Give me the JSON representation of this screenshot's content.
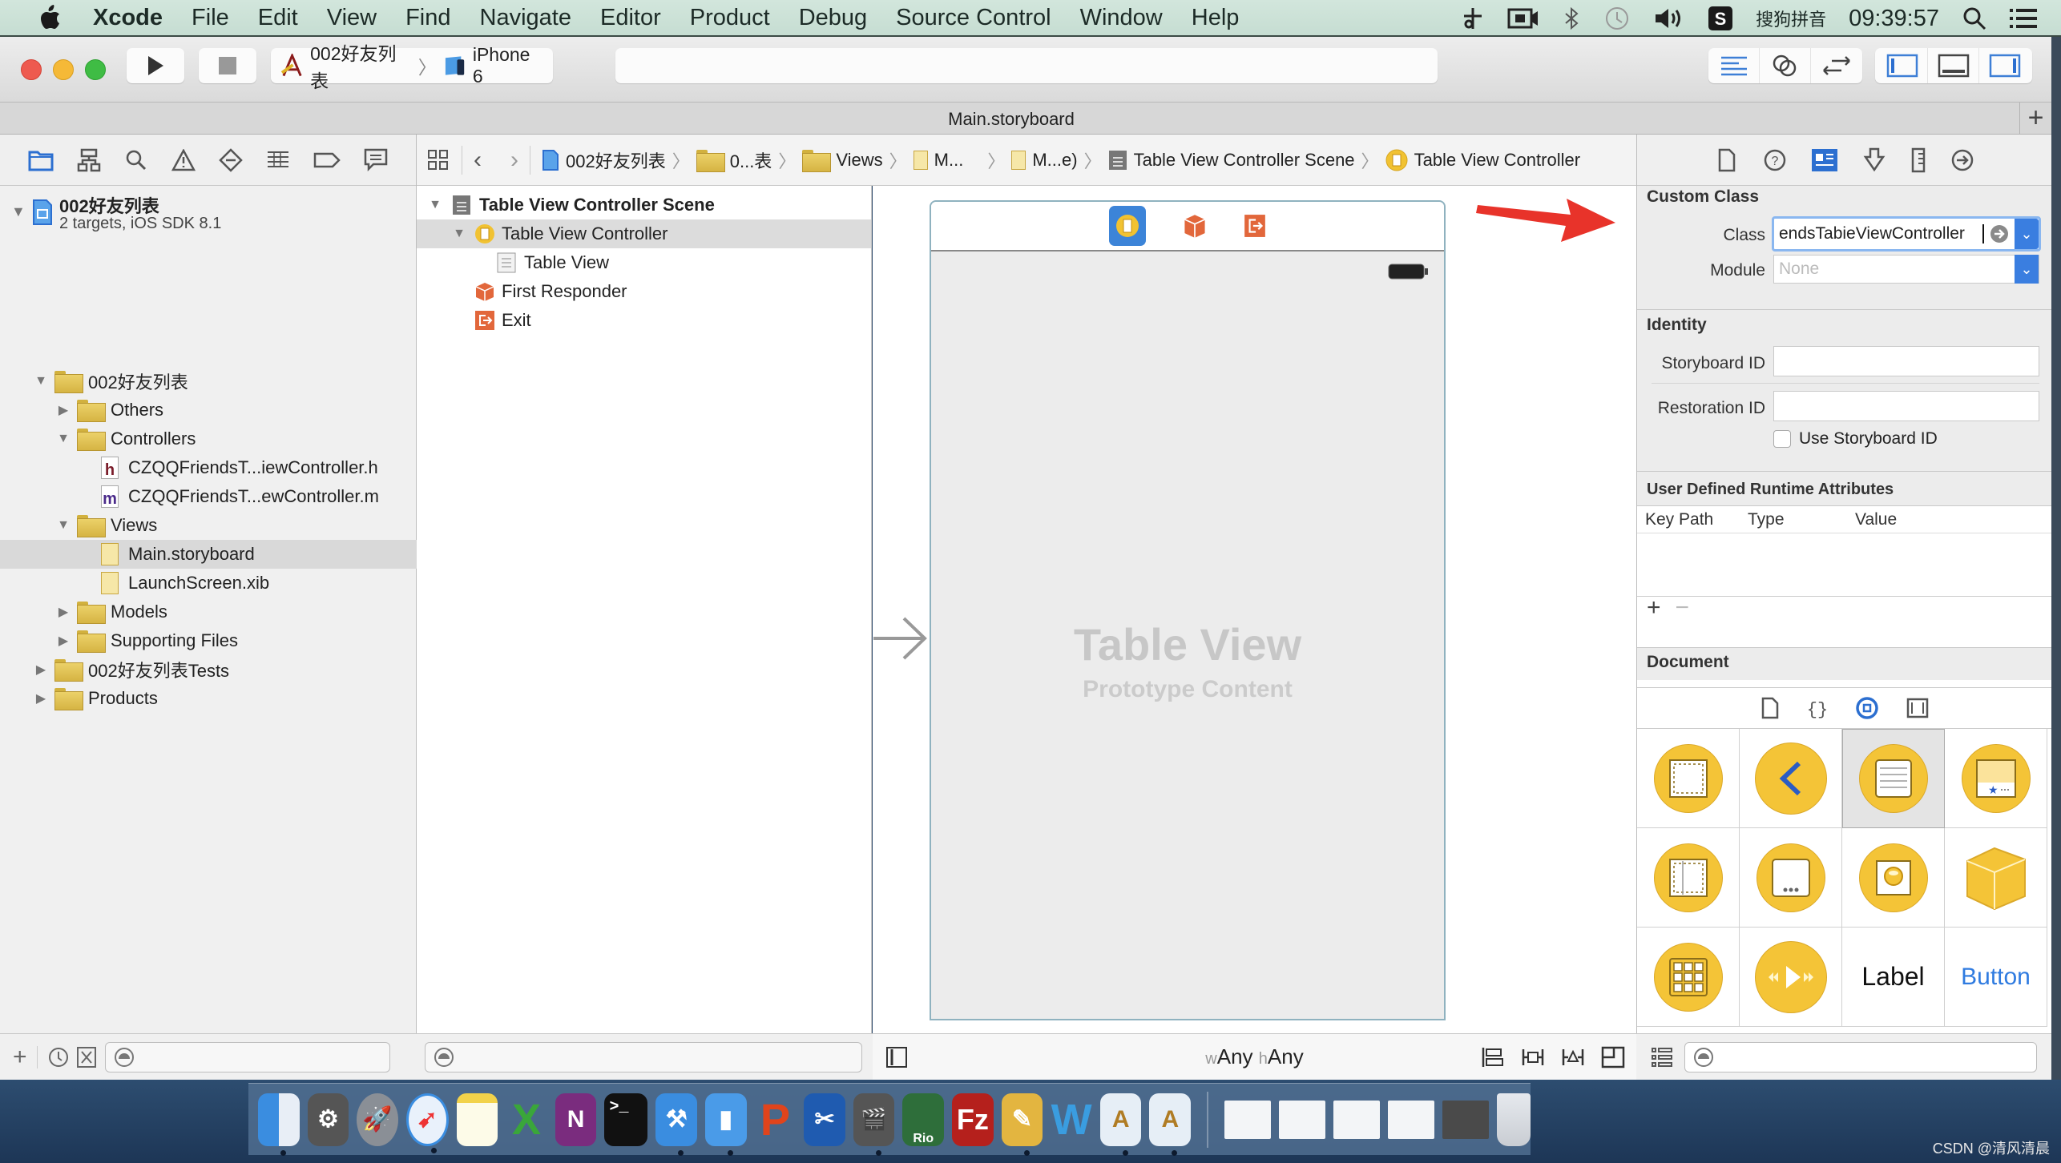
{
  "menubar": {
    "app_name": "Xcode",
    "items": [
      "File",
      "Edit",
      "View",
      "Find",
      "Navigate",
      "Editor",
      "Product",
      "Debug",
      "Source Control",
      "Window",
      "Help"
    ],
    "status_icons": [
      "scissors-icon",
      "screen-record-icon",
      "bluetooth-icon",
      "time-machine-icon",
      "volume-icon"
    ],
    "input_method": "搜狗拼音",
    "clock": "09:39:57"
  },
  "toolbar": {
    "scheme_name": "002好友列表",
    "device": "iPhone 6"
  },
  "tab": {
    "title": "Main.storyboard"
  },
  "navigator": {
    "project": {
      "name": "002好友列表",
      "subtitle": "2 targets, iOS SDK 8.1"
    },
    "items": [
      {
        "label": "002好友列表",
        "kind": "folder",
        "expanded": true,
        "depth": 1
      },
      {
        "label": "Others",
        "kind": "folder",
        "expanded": false,
        "depth": 2
      },
      {
        "label": "Controllers",
        "kind": "folder",
        "expanded": true,
        "depth": 2
      },
      {
        "label": "CZQQFriendsT...iewController.h",
        "kind": "file-h",
        "depth": 3
      },
      {
        "label": "CZQQFriendsT...ewController.m",
        "kind": "file-m",
        "depth": 3
      },
      {
        "label": "Views",
        "kind": "folder",
        "expanded": true,
        "depth": 2
      },
      {
        "label": "Main.storyboard",
        "kind": "storyboard",
        "depth": 3,
        "selected": true
      },
      {
        "label": "LaunchScreen.xib",
        "kind": "xib",
        "depth": 3
      },
      {
        "label": "Models",
        "kind": "folder",
        "expanded": false,
        "depth": 2
      },
      {
        "label": "Supporting Files",
        "kind": "folder",
        "expanded": false,
        "depth": 2
      },
      {
        "label": "002好友列表Tests",
        "kind": "folder",
        "expanded": false,
        "depth": 1
      },
      {
        "label": "Products",
        "kind": "folder",
        "expanded": false,
        "depth": 1
      }
    ]
  },
  "jumpbar": {
    "crumbs": [
      "002好友列表",
      "0...表",
      "Views",
      "M...",
      "M...e)",
      "Table View Controller Scene",
      "Table View Controller"
    ]
  },
  "outline": {
    "scene": "Table View Controller Scene",
    "controller": "Table View Controller",
    "table_view": "Table View",
    "first_responder": "First Responder",
    "exit": "Exit"
  },
  "canvas": {
    "placeholder_title": "Table View",
    "placeholder_subtitle": "Prototype Content",
    "size_class_w_prefix": "w",
    "size_class_w": "Any",
    "size_class_h_prefix": "h",
    "size_class_h": "Any"
  },
  "inspector": {
    "custom_class": {
      "title": "Custom Class",
      "class_label": "Class",
      "class_value": "endsTabieViewController",
      "module_label": "Module",
      "module_placeholder": "None"
    },
    "identity": {
      "title": "Identity",
      "storyboard_id_label": "Storyboard ID",
      "storyboard_id_value": "",
      "restoration_id_label": "Restoration ID",
      "restoration_id_value": "",
      "use_storyboard_id_label": "Use Storyboard ID",
      "use_storyboard_id_checked": false
    },
    "runtime_attributes": {
      "title": "User Defined Runtime Attributes",
      "columns": [
        "Key Path",
        "Type",
        "Value"
      ]
    },
    "document": {
      "title": "Document"
    },
    "library": {
      "items": [
        "view-controller",
        "navigation-controller",
        "table-view-controller",
        "tab-bar-controller",
        "split-view-controller",
        "page-view-controller",
        "glkit-view-controller",
        "object",
        "collection-view-controller",
        "av-player-view-controller",
        "Label",
        "Button"
      ],
      "selected_index": 2
    }
  },
  "dock": {
    "apps": [
      "Finder",
      "System Preferences",
      "Launchpad",
      "Safari",
      "Notes",
      "Excel",
      "OneNote",
      "Terminal",
      "Xcode",
      "Simulator",
      "PowerPoint",
      "Screenshot",
      "Video",
      "Rio",
      "FileZilla",
      "Sketch",
      "Word",
      "Xcode Project",
      "Xcode Project"
    ]
  },
  "watermark": "CSDN @清风清晨"
}
